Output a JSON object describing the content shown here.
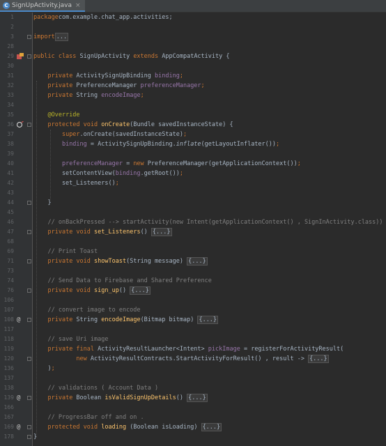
{
  "tab": {
    "filename": "SignUpActivity.java",
    "icon": "C",
    "close": "×"
  },
  "colors": {
    "background": "#2b2b2b",
    "keyword": "#cc7832",
    "method": "#ffc66d",
    "field": "#9876aa",
    "comment": "#808080",
    "annotation": "#bbb529",
    "text": "#a9b7c6"
  },
  "lines": [
    {
      "n": "1",
      "icon": "",
      "fold": false,
      "segs": [
        [
          "kw",
          "package"
        ],
        [
          "",
          "com.example.chat_app.activities;"
        ]
      ]
    },
    {
      "n": "2",
      "icon": "",
      "fold": false,
      "segs": []
    },
    {
      "n": "3",
      "icon": "",
      "fold": true,
      "segs": [
        [
          "kw",
          "import"
        ],
        [
          "",
          ""
        ],
        [
          "box",
          "..."
        ]
      ]
    },
    {
      "n": "28",
      "icon": "",
      "fold": false,
      "segs": []
    },
    {
      "n": "29",
      "icon": "class",
      "fold": true,
      "segs": [
        [
          "kw",
          "public class"
        ],
        [
          "",
          " SignUpActivity "
        ],
        [
          "kw",
          "extends"
        ],
        [
          "",
          " AppCompatActivity {"
        ]
      ]
    },
    {
      "n": "30",
      "icon": "",
      "fold": false,
      "segs": []
    },
    {
      "n": "31",
      "icon": "",
      "fold": false,
      "segs": [
        [
          "",
          "    "
        ],
        [
          "kw",
          "private"
        ],
        [
          "",
          " ActivitySignUpBinding "
        ],
        [
          "fld",
          "binding"
        ],
        [
          "kw",
          ";"
        ]
      ]
    },
    {
      "n": "32",
      "icon": "",
      "fold": false,
      "segs": [
        [
          "",
          "    "
        ],
        [
          "kw",
          "private"
        ],
        [
          "",
          " PreferenceManager "
        ],
        [
          "fld",
          "preferenceManager"
        ],
        [
          "kw",
          ";"
        ]
      ]
    },
    {
      "n": "33",
      "icon": "",
      "fold": false,
      "segs": [
        [
          "",
          "    "
        ],
        [
          "kw",
          "private"
        ],
        [
          "",
          " String "
        ],
        [
          "fld",
          "encodeImage"
        ],
        [
          "kw",
          ";"
        ]
      ]
    },
    {
      "n": "34",
      "icon": "",
      "fold": false,
      "segs": []
    },
    {
      "n": "35",
      "icon": "",
      "fold": false,
      "segs": [
        [
          "",
          "    "
        ],
        [
          "an",
          "@Override"
        ]
      ]
    },
    {
      "n": "36",
      "icon": "override",
      "fold": true,
      "segs": [
        [
          "",
          "    "
        ],
        [
          "kw",
          "protected void"
        ],
        [
          "",
          " "
        ],
        [
          "fn",
          "onCreate"
        ],
        [
          "",
          "(Bundle savedInstanceState) {"
        ]
      ]
    },
    {
      "n": "37",
      "icon": "",
      "fold": false,
      "segs": [
        [
          "",
          "        "
        ],
        [
          "kw",
          "super"
        ],
        [
          "",
          ".onCreate(savedInstanceState)"
        ],
        [
          "kw",
          ";"
        ]
      ]
    },
    {
      "n": "38",
      "icon": "",
      "fold": false,
      "segs": [
        [
          "",
          "        "
        ],
        [
          "fld",
          "binding"
        ],
        [
          "",
          " = ActivitySignUpBinding."
        ],
        [
          "it",
          "inflate"
        ],
        [
          "",
          "(getLayoutInflater())"
        ],
        [
          "kw",
          ";"
        ]
      ]
    },
    {
      "n": "39",
      "icon": "",
      "fold": false,
      "segs": []
    },
    {
      "n": "40",
      "icon": "",
      "fold": false,
      "segs": [
        [
          "",
          "        "
        ],
        [
          "fld",
          "preferenceManager"
        ],
        [
          "",
          " = "
        ],
        [
          "kw",
          "new"
        ],
        [
          "",
          " PreferenceManager(getApplicationContext())"
        ],
        [
          "kw",
          ";"
        ]
      ]
    },
    {
      "n": "41",
      "icon": "",
      "fold": false,
      "segs": [
        [
          "",
          "        setContentView("
        ],
        [
          "fld",
          "binding"
        ],
        [
          "",
          ".getRoot())"
        ],
        [
          "kw",
          ";"
        ]
      ]
    },
    {
      "n": "42",
      "icon": "",
      "fold": false,
      "segs": [
        [
          "",
          "        set_Listeners()"
        ],
        [
          "kw",
          ";"
        ]
      ]
    },
    {
      "n": "43",
      "icon": "",
      "fold": false,
      "segs": []
    },
    {
      "n": "44",
      "icon": "",
      "fold": true,
      "segs": [
        [
          "",
          "    }"
        ]
      ]
    },
    {
      "n": "45",
      "icon": "",
      "fold": false,
      "segs": []
    },
    {
      "n": "46",
      "icon": "",
      "fold": false,
      "segs": [
        [
          "",
          "    "
        ],
        [
          "cm",
          "// onBackPressed --> startActivity(new Intent(getApplicationContext() , SignInActivity.class))"
        ]
      ]
    },
    {
      "n": "47",
      "icon": "",
      "fold": true,
      "segs": [
        [
          "",
          "    "
        ],
        [
          "kw",
          "private void"
        ],
        [
          "",
          " "
        ],
        [
          "fn",
          "set_Listeners"
        ],
        [
          "",
          "() "
        ],
        [
          "box",
          "{...}"
        ]
      ]
    },
    {
      "n": "68",
      "icon": "",
      "fold": false,
      "segs": []
    },
    {
      "n": "69",
      "icon": "",
      "fold": false,
      "segs": [
        [
          "",
          "    "
        ],
        [
          "cm",
          "// Print Toast"
        ]
      ]
    },
    {
      "n": "71",
      "icon": "",
      "fold": true,
      "segs": [
        [
          "",
          "    "
        ],
        [
          "kw",
          "private void"
        ],
        [
          "",
          " "
        ],
        [
          "fn",
          "showToast"
        ],
        [
          "",
          "(String message) "
        ],
        [
          "box",
          "{...}"
        ]
      ]
    },
    {
      "n": "73",
      "icon": "",
      "fold": false,
      "segs": []
    },
    {
      "n": "74",
      "icon": "",
      "fold": false,
      "segs": [
        [
          "",
          "    "
        ],
        [
          "cm",
          "// Send Data to Firebase and Shared Preference"
        ]
      ]
    },
    {
      "n": "76",
      "icon": "",
      "fold": true,
      "segs": [
        [
          "",
          "    "
        ],
        [
          "kw",
          "private void"
        ],
        [
          "",
          " "
        ],
        [
          "fn",
          "sign_up"
        ],
        [
          "",
          "() "
        ],
        [
          "box",
          "{...}"
        ]
      ]
    },
    {
      "n": "106",
      "icon": "",
      "fold": false,
      "segs": []
    },
    {
      "n": "107",
      "icon": "",
      "fold": false,
      "segs": [
        [
          "",
          "    "
        ],
        [
          "cm",
          "// convert image to encode"
        ]
      ]
    },
    {
      "n": "108",
      "icon": "at",
      "fold": true,
      "segs": [
        [
          "",
          "    "
        ],
        [
          "kw",
          "private"
        ],
        [
          "",
          " String "
        ],
        [
          "fn",
          "encodeImage"
        ],
        [
          "",
          "(Bitmap bitmap) "
        ],
        [
          "box",
          "{...}"
        ]
      ]
    },
    {
      "n": "117",
      "icon": "",
      "fold": false,
      "segs": []
    },
    {
      "n": "118",
      "icon": "",
      "fold": false,
      "segs": [
        [
          "",
          "    "
        ],
        [
          "cm",
          "// save Uri image"
        ]
      ]
    },
    {
      "n": "119",
      "icon": "",
      "fold": false,
      "segs": [
        [
          "",
          "    "
        ],
        [
          "kw",
          "private final"
        ],
        [
          "",
          " ActivityResultLauncher<Intent> "
        ],
        [
          "fld",
          "pickImage"
        ],
        [
          "",
          " = registerForActivityResult("
        ]
      ]
    },
    {
      "n": "120",
      "icon": "",
      "fold": true,
      "segs": [
        [
          "",
          "            "
        ],
        [
          "kw",
          "new"
        ],
        [
          "",
          " ActivityResultContracts.StartActivityForResult() , result -> "
        ],
        [
          "box",
          "{...}"
        ]
      ]
    },
    {
      "n": "136",
      "icon": "",
      "fold": false,
      "segs": [
        [
          "",
          "    )"
        ],
        [
          "kw",
          ";"
        ]
      ]
    },
    {
      "n": "137",
      "icon": "",
      "fold": false,
      "segs": []
    },
    {
      "n": "138",
      "icon": "",
      "fold": false,
      "segs": [
        [
          "",
          "    "
        ],
        [
          "cm",
          "// validations ( Account Data )"
        ]
      ]
    },
    {
      "n": "139",
      "icon": "at",
      "fold": true,
      "segs": [
        [
          "",
          "    "
        ],
        [
          "kw",
          "private"
        ],
        [
          "",
          " Boolean "
        ],
        [
          "fn",
          "isValidSignUpDetails"
        ],
        [
          "",
          "() "
        ],
        [
          "box",
          "{...}"
        ]
      ]
    },
    {
      "n": "166",
      "icon": "",
      "fold": false,
      "segs": []
    },
    {
      "n": "167",
      "icon": "",
      "fold": false,
      "segs": [
        [
          "",
          "    "
        ],
        [
          "cm",
          "// ProgressBar off and on ."
        ]
      ]
    },
    {
      "n": "169",
      "icon": "at",
      "fold": true,
      "segs": [
        [
          "",
          "    "
        ],
        [
          "kw",
          "protected void"
        ],
        [
          "",
          " "
        ],
        [
          "fn",
          "loading"
        ],
        [
          "",
          " (Boolean isLoading) "
        ],
        [
          "box",
          "{...}"
        ]
      ]
    },
    {
      "n": "178",
      "icon": "",
      "fold": true,
      "segs": [
        [
          "",
          "}"
        ]
      ]
    }
  ]
}
